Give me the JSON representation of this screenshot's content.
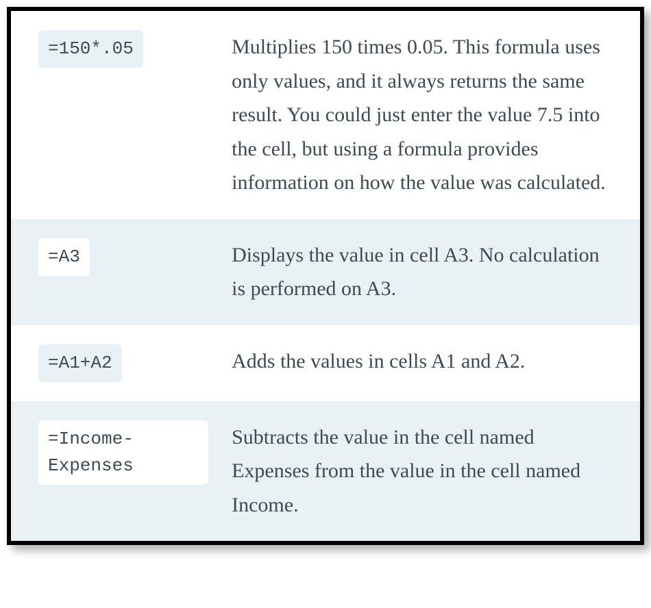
{
  "rows": [
    {
      "formula": "=150*.05",
      "description": "Multiplies 150 times 0.05. This formula uses only values, and it always returns the same result. You could just enter the value 7.5 into the cell, but using a formula provides information on how the value was calculated."
    },
    {
      "formula": "=A3",
      "description": "Displays the value in cell A3. No calculation is performed on A3."
    },
    {
      "formula": "=A1+A2",
      "description": "Adds the values in cells A1 and A2."
    },
    {
      "formula": "=Income-Expenses",
      "description": "Subtracts the value in the cell named Expenses from the value in the cell named Income."
    }
  ]
}
